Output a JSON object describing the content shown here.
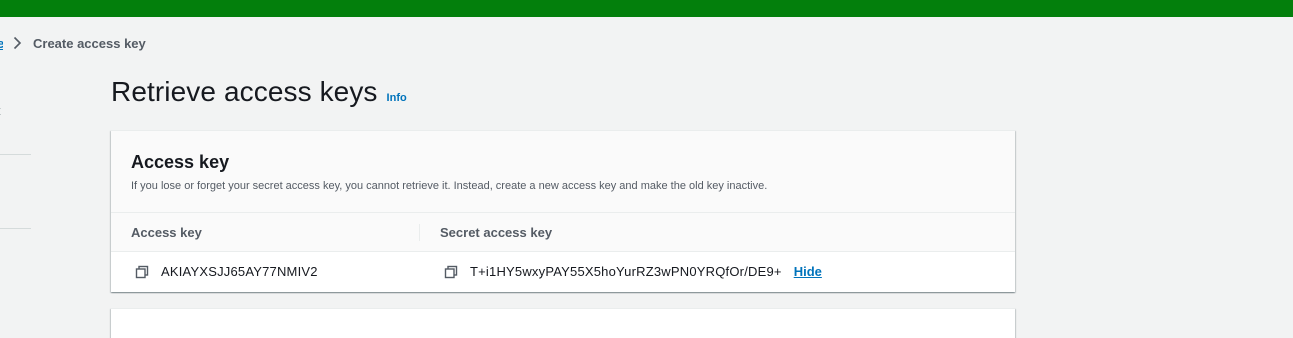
{
  "colors": {
    "banner": "#037f0c",
    "link": "#0073bb",
    "background": "#f2f3f3"
  },
  "breadcrumb": {
    "parent_label": "e",
    "current_label": "Create access key"
  },
  "sidebar": {
    "stub_text": "t"
  },
  "header": {
    "title": "Retrieve access keys",
    "info_label": "Info"
  },
  "panel": {
    "title": "Access key",
    "description": "If you lose or forget your secret access key, you cannot retrieve it. Instead, create a new access key and make the old key inactive.",
    "columns": [
      "Access key",
      "Secret access key"
    ],
    "row": {
      "access_key": "AKIAYXSJJ65AY77NMIV2",
      "secret_access_key": "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",
      "hide_label": "Hide"
    }
  },
  "icons": {
    "copy": "copy-icon",
    "chevron": "chevron-right-icon"
  }
}
